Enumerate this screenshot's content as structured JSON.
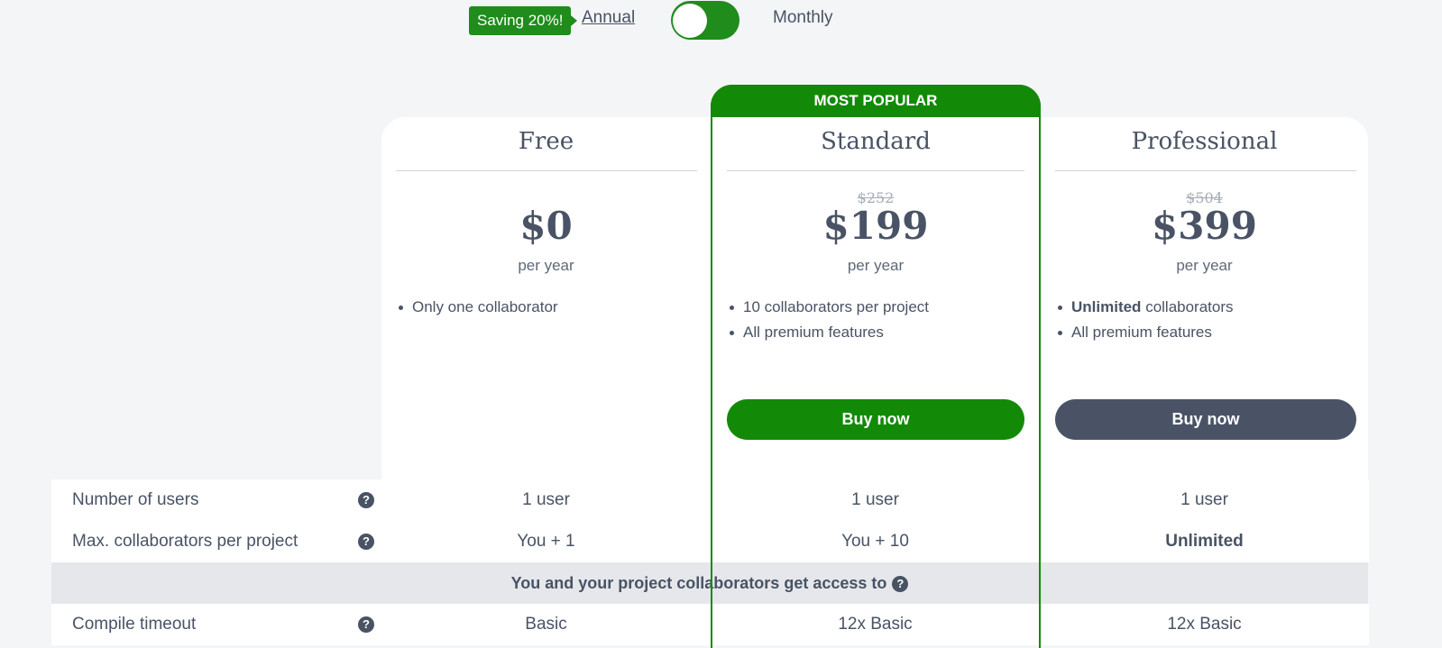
{
  "billing": {
    "saving_badge": "Saving 20%!",
    "annual_label": "Annual",
    "monthly_label": "Monthly"
  },
  "popular_label": "MOST POPULAR",
  "plans": [
    {
      "name": "Free",
      "old_price": "",
      "price": "$0",
      "period": "per year",
      "features": [
        "Only one collaborator"
      ],
      "button": ""
    },
    {
      "name": "Standard",
      "old_price": "$252",
      "price": "$199",
      "period": "per year",
      "features": [
        "10 collaborators per project",
        "All premium features"
      ],
      "button": "Buy now"
    },
    {
      "name": "Professional",
      "old_price": "$504",
      "price": "$399",
      "period": "per year",
      "features_bold_prefix": "Unlimited",
      "features": [
        "collaborators",
        "All premium features"
      ],
      "button": "Buy now"
    }
  ],
  "table": {
    "rows": [
      {
        "label": "Number of users",
        "values": [
          "1 user",
          "1 user",
          "1 user"
        ]
      },
      {
        "label": "Max. collaborators per project",
        "values": [
          "You + 1",
          "You + 10",
          "Unlimited"
        ]
      }
    ],
    "section": "You and your project collaborators get access to",
    "rows2": [
      {
        "label": "Compile timeout",
        "values": [
          "Basic",
          "12x Basic",
          "12x Basic"
        ]
      }
    ],
    "help_glyph": "?"
  },
  "colors": {
    "accent_green": "#138a07",
    "dark_button": "#4a5366",
    "text": "#495365",
    "background": "#f4f5f6"
  }
}
